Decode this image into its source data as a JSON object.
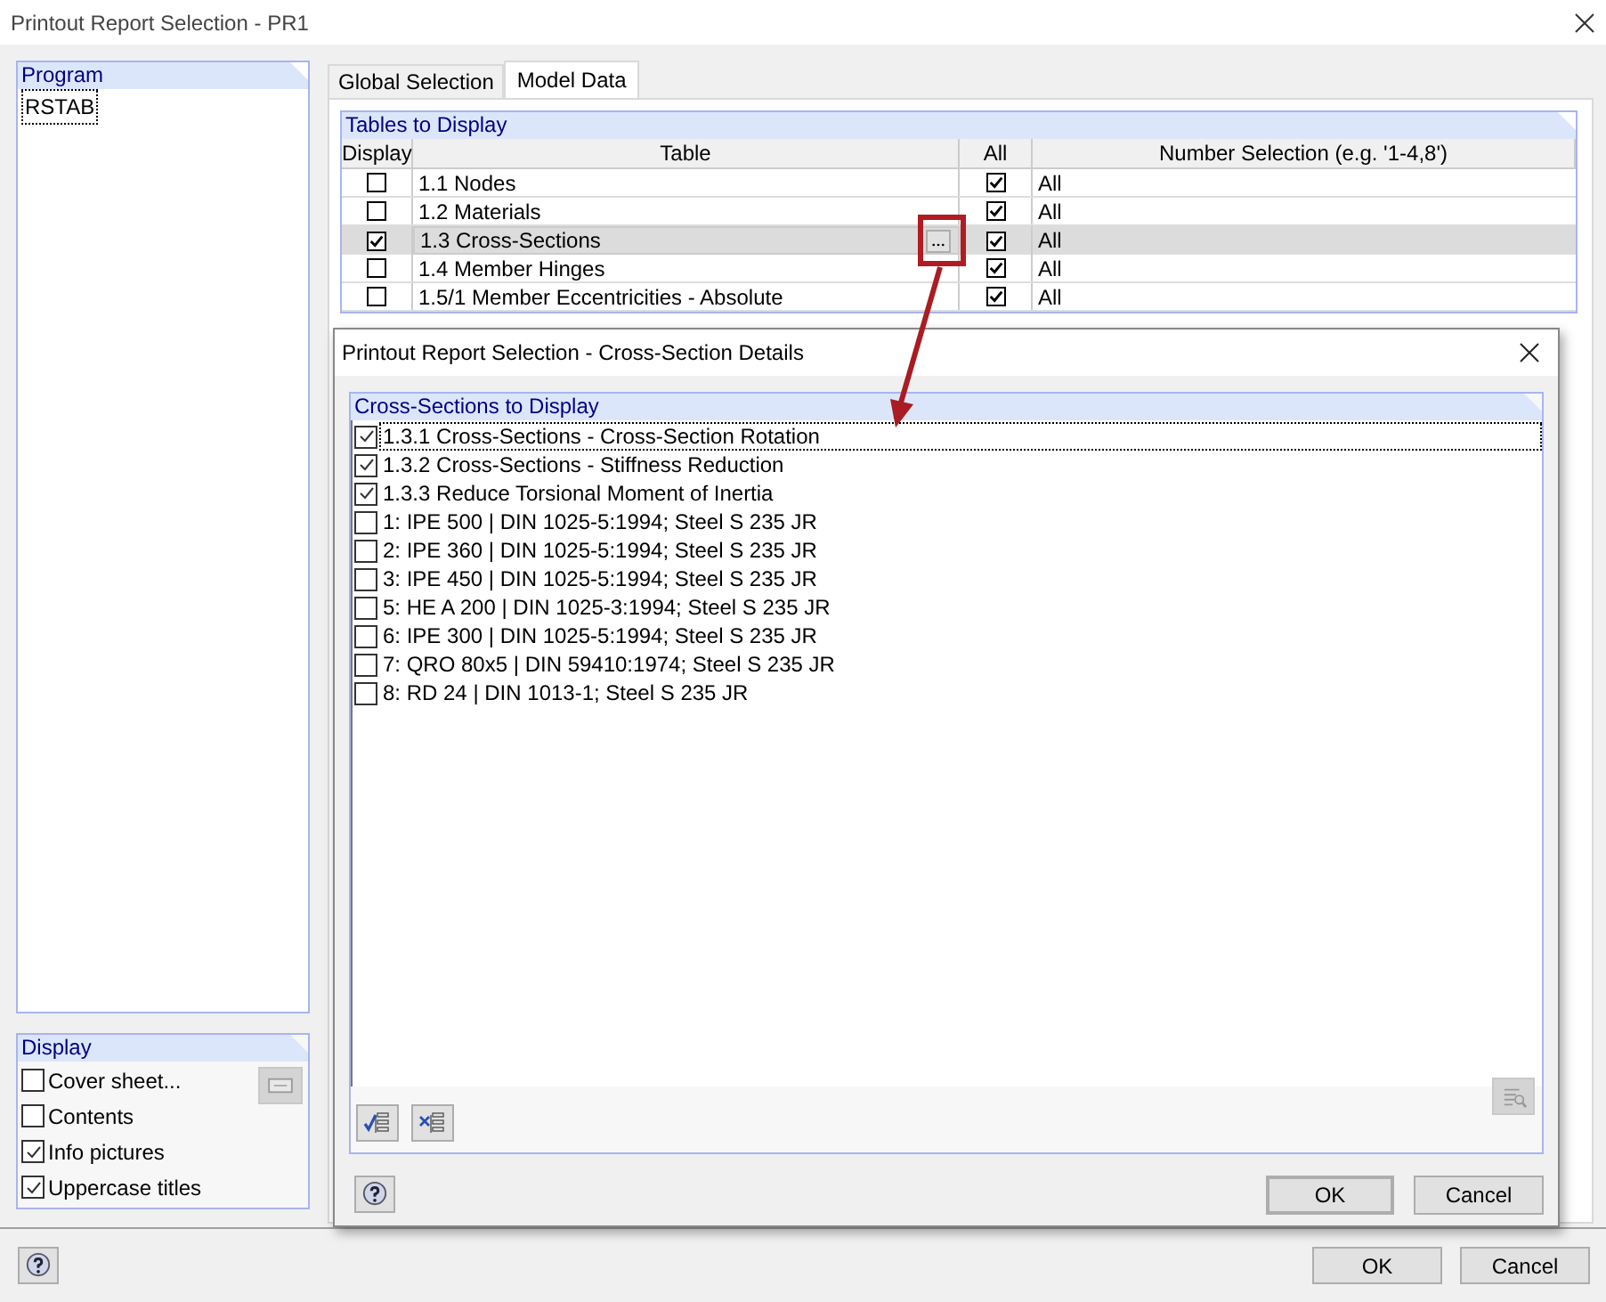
{
  "window": {
    "title": "Printout Report Selection - PR1"
  },
  "program": {
    "title": "Program",
    "items": [
      {
        "label": "RSTAB",
        "selected": true
      }
    ]
  },
  "display": {
    "title": "Display",
    "options": [
      {
        "label": "Cover sheet...",
        "checked": false
      },
      {
        "label": "Contents",
        "checked": false
      },
      {
        "label": "Info pictures",
        "checked": true
      },
      {
        "label": "Uppercase titles",
        "checked": true
      }
    ]
  },
  "tabs": [
    {
      "label": "Global Selection",
      "selected": false
    },
    {
      "label": "Model Data",
      "selected": true
    }
  ],
  "tables_group": {
    "title": "Tables to Display",
    "columns": [
      "Display",
      "Table",
      "All",
      "Number Selection (e.g. '1-4,8')"
    ],
    "rows": [
      {
        "display": false,
        "table": "1.1 Nodes",
        "all": true,
        "number_selection": "All",
        "selected": false
      },
      {
        "display": false,
        "table": "1.2 Materials",
        "all": true,
        "number_selection": "All",
        "selected": false
      },
      {
        "display": true,
        "table": "1.3 Cross-Sections",
        "all": true,
        "number_selection": "All",
        "selected": true
      },
      {
        "display": false,
        "table": "1.4 Member Hinges",
        "all": true,
        "number_selection": "All",
        "selected": false
      },
      {
        "display": false,
        "table": "1.5/1 Member Eccentricities - Absolute",
        "all": true,
        "number_selection": "All",
        "selected": false
      }
    ]
  },
  "buttons": [
    "OK",
    "Cancel"
  ],
  "dialog": {
    "title": "Printout Report Selection - Cross-Section Details",
    "group_title": "Cross-Sections to Display",
    "items": [
      {
        "label": "1.3.1 Cross-Sections - Cross-Section Rotation",
        "checked": true,
        "selected": true
      },
      {
        "label": "1.3.2 Cross-Sections - Stiffness Reduction",
        "checked": true,
        "selected": false
      },
      {
        "label": "1.3.3 Reduce Torsional Moment of Inertia",
        "checked": true,
        "selected": false
      },
      {
        "label": "1: IPE 500 | DIN 1025-5:1994; Steel S 235 JR",
        "checked": false,
        "selected": false
      },
      {
        "label": "2: IPE 360 | DIN 1025-5:1994; Steel S 235 JR",
        "checked": false,
        "selected": false
      },
      {
        "label": "3: IPE 450 | DIN 1025-5:1994; Steel S 235 JR",
        "checked": false,
        "selected": false
      },
      {
        "label": "5: HE A 200 | DIN 1025-3:1994; Steel S 235 JR",
        "checked": false,
        "selected": false
      },
      {
        "label": "6: IPE 300 | DIN 1025-5:1994; Steel S 235 JR",
        "checked": false,
        "selected": false
      },
      {
        "label": "7: QRO 80x5 | DIN 59410:1974; Steel S 235 JR",
        "checked": false,
        "selected": false
      },
      {
        "label": "8: RD 24 | DIN 1013-1; Steel S 235 JR",
        "checked": false,
        "selected": false
      }
    ],
    "buttons": [
      "OK",
      "Cancel"
    ]
  }
}
